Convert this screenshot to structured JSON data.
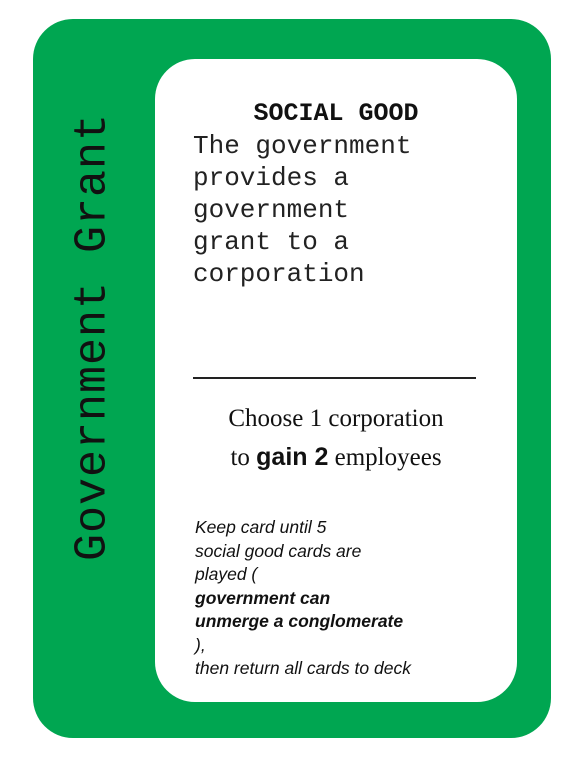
{
  "card": {
    "side_title": "Government Grant",
    "category": "SOCIAL GOOD",
    "flavor_lines": [
      "The government",
      "provides a",
      "government",
      "grant to a",
      "corporation"
    ],
    "effect": {
      "line1": "Choose 1 corporation",
      "line2_prefix": "to ",
      "line2_bold": "gain 2",
      "line2_suffix": " employees"
    },
    "note": {
      "line1": "Keep card until 5",
      "line2": "social good cards are",
      "line3_prefix": "played (",
      "line3_bold": "government can",
      "line4_bold": "unmerge a conglomerate",
      "line4_suffix": "),",
      "line5": "then return all cards to deck"
    }
  },
  "colors": {
    "card_background": "#00a651",
    "panel_background": "#ffffff",
    "text": "#111111"
  }
}
